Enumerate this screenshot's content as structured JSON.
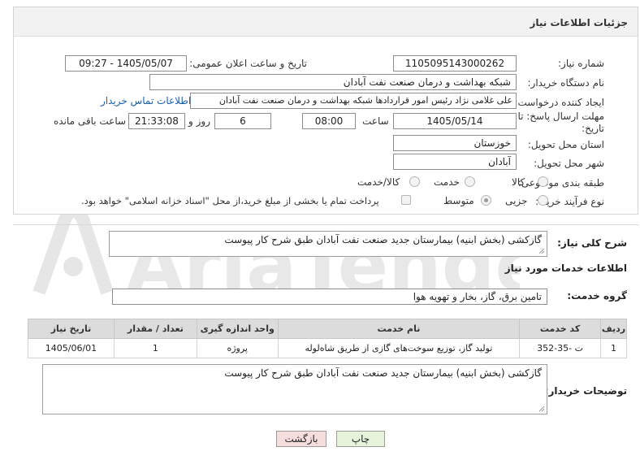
{
  "header": {
    "title": "جزئیات اطلاعات نیاز"
  },
  "fields": {
    "need_number_label": "شماره نیاز:",
    "need_number": "1105095143000262",
    "announce_label": "تاریخ و ساعت اعلان عمومی:",
    "announce_value": "1405/05/07 - 09:27",
    "buyer_org_label": "نام دستگاه خریدار:",
    "buyer_org": "شبکه بهداشت و درمان صنعت نفت آبادان",
    "creator_label": "ایجاد کننده درخواست:",
    "creator": "علی غلامی نژاد رئیس امور قراردادها شبکه بهداشت و درمان صنعت نفت آبادان",
    "contact_link": "اطلاعات تماس خریدار",
    "deadline_label_1": "مهلت ارسال پاسخ: تا",
    "deadline_label_2": "تاریخ:",
    "deadline_date": "1405/05/14",
    "time_label": "ساعت",
    "deadline_time": "08:00",
    "days_value": "6",
    "days_label": "روز و",
    "remaining_time": "21:33:08",
    "remaining_label": "ساعت باقی مانده",
    "province_label": "استان محل تحویل:",
    "province": "خوزستان",
    "city_label": "شهر محل تحویل:",
    "city": "آبادان",
    "category_label": "طبقه بندی موضوعی:",
    "category_options": [
      "کالا",
      "خدمت",
      "کالا/خدمت"
    ],
    "purchase_type_label": "نوع فرآیند خرید :",
    "purchase_options": [
      "جزیی",
      "متوسط"
    ],
    "payment_note": "پرداخت تمام یا بخشی از مبلغ خرید،از محل \"اسناد خزانه اسلامی\" خواهد بود."
  },
  "summary": {
    "label": "شرح کلی نیاز:",
    "text": "گازکشی (بخش ابنیه) بیمارستان جدید صنعت نفت آبادان طبق شرح کار پیوست"
  },
  "services": {
    "section_title": "اطلاعات خدمات مورد نیاز",
    "group_label": "گروه خدمت:",
    "group_value": "تامین برق، گاز، بخار و تهویه هوا",
    "columns": [
      "ردیف",
      "کد خدمت",
      "نام خدمت",
      "واحد اندازه گیری",
      "تعداد / مقدار",
      "تاریخ نیاز"
    ],
    "rows": [
      [
        "1",
        "ت -35-352",
        "تولید گاز، توزیع سوخت‌های گازی از طریق شاه‌لوله",
        "پروژه",
        "1",
        "1405/06/01"
      ]
    ]
  },
  "buyer_notes": {
    "label": "توضیحات خریدار:",
    "text": "گازکشی (بخش ابنیه) بیمارستان جدید صنعت نفت آبادان طبق شرح کار پیوست"
  },
  "buttons": {
    "print": "چاپ",
    "back": "بازگشت"
  },
  "watermark": {
    "text": "AriaTender.net"
  },
  "colors": {
    "link": "#1a5ea8",
    "back_button": "#f7dede",
    "print_button": "#e6f4dc",
    "watermark": "#e3e3e3"
  }
}
